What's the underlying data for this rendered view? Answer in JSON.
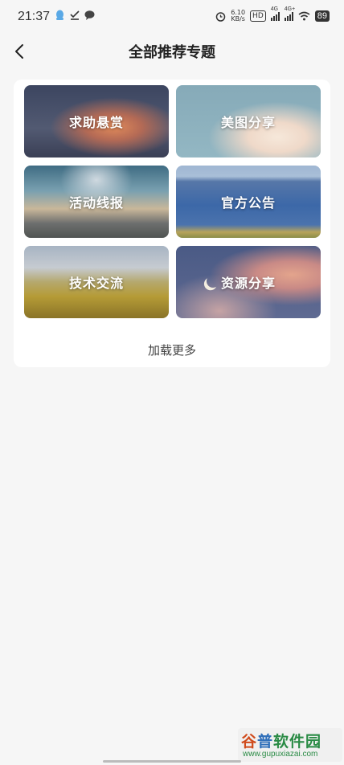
{
  "status_bar": {
    "time": "21:37",
    "network_speed_value": "6.10",
    "network_speed_unit": "KB/s",
    "hd_badge": "HD",
    "signal1_label": "4G",
    "signal2_label": "4G+",
    "battery": "89",
    "icons": [
      "qq-icon",
      "download-check-icon",
      "chat-bubble-icon",
      "alarm-icon",
      "wifi-icon"
    ]
  },
  "header": {
    "back_icon": "chevron-left-icon",
    "title": "全部推荐专题"
  },
  "topics": [
    {
      "label": "求助悬赏"
    },
    {
      "label": "美图分享"
    },
    {
      "label": "活动线报"
    },
    {
      "label": "官方公告"
    },
    {
      "label": "技术交流"
    },
    {
      "label": "资源分享"
    }
  ],
  "load_more": "加载更多",
  "watermark": {
    "logo_a": "谷",
    "logo_b": "普",
    "logo_c": "软件园",
    "url": "www.gupuxiazai.com"
  }
}
